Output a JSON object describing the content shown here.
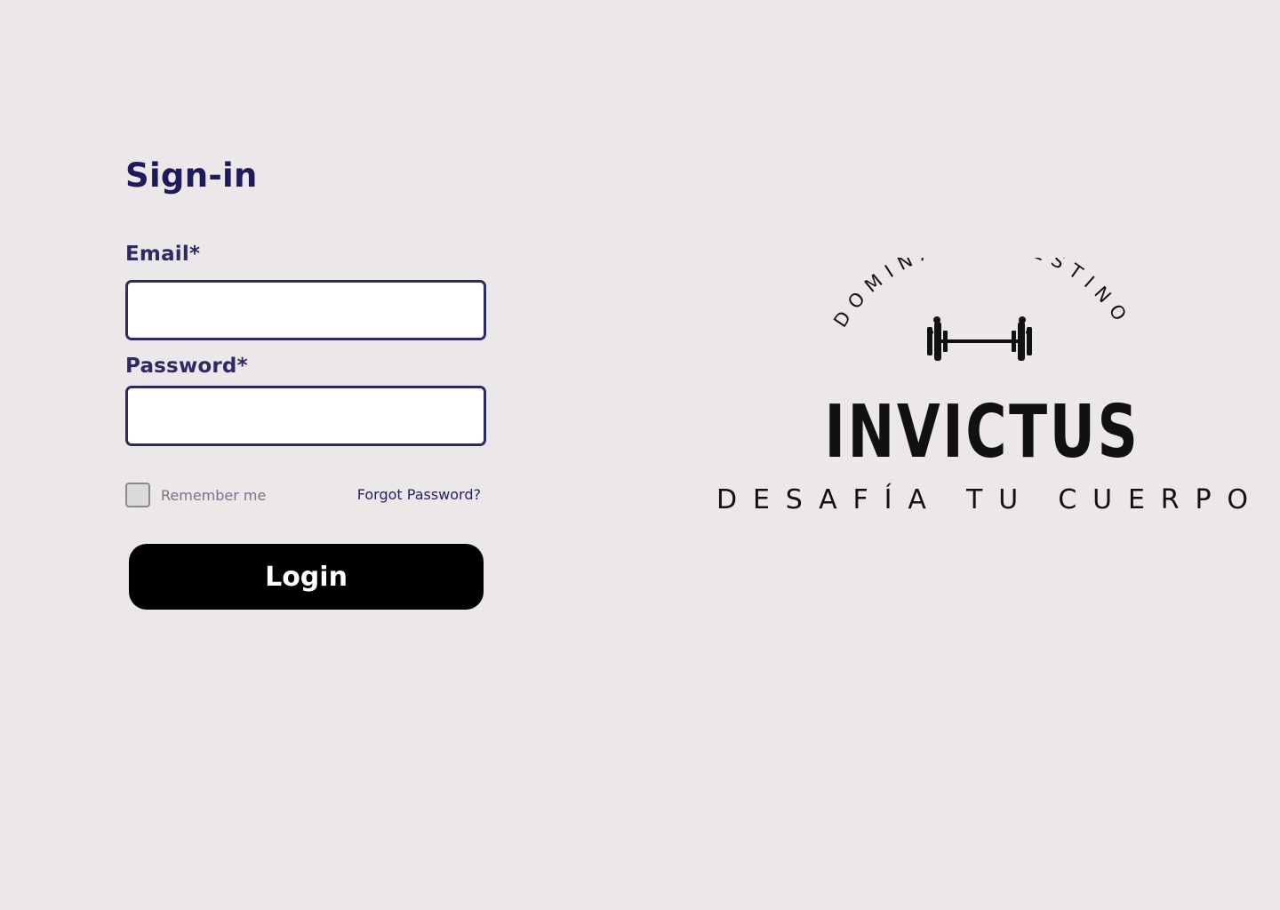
{
  "signin": {
    "title": "Sign-in",
    "email_label": "Email*",
    "email_value": "",
    "password_label": "Password*",
    "password_value": "",
    "remember_label": "Remember me",
    "remember_checked": false,
    "forgot_link": "Forgot Password?",
    "login_button": "Login"
  },
  "brand": {
    "tagline_top": "DOMINA TU DESTINO",
    "name": "INVICTUS",
    "tagline_bottom": "DESAFÍA TU CUERPO",
    "icon": "dumbbell-icon"
  },
  "colors": {
    "background": "#ece8e9",
    "title": "#1f1a5c",
    "field_border": "#2e2a62",
    "button": "#000000",
    "button_text": "#ffffff",
    "logo": "#111111"
  }
}
